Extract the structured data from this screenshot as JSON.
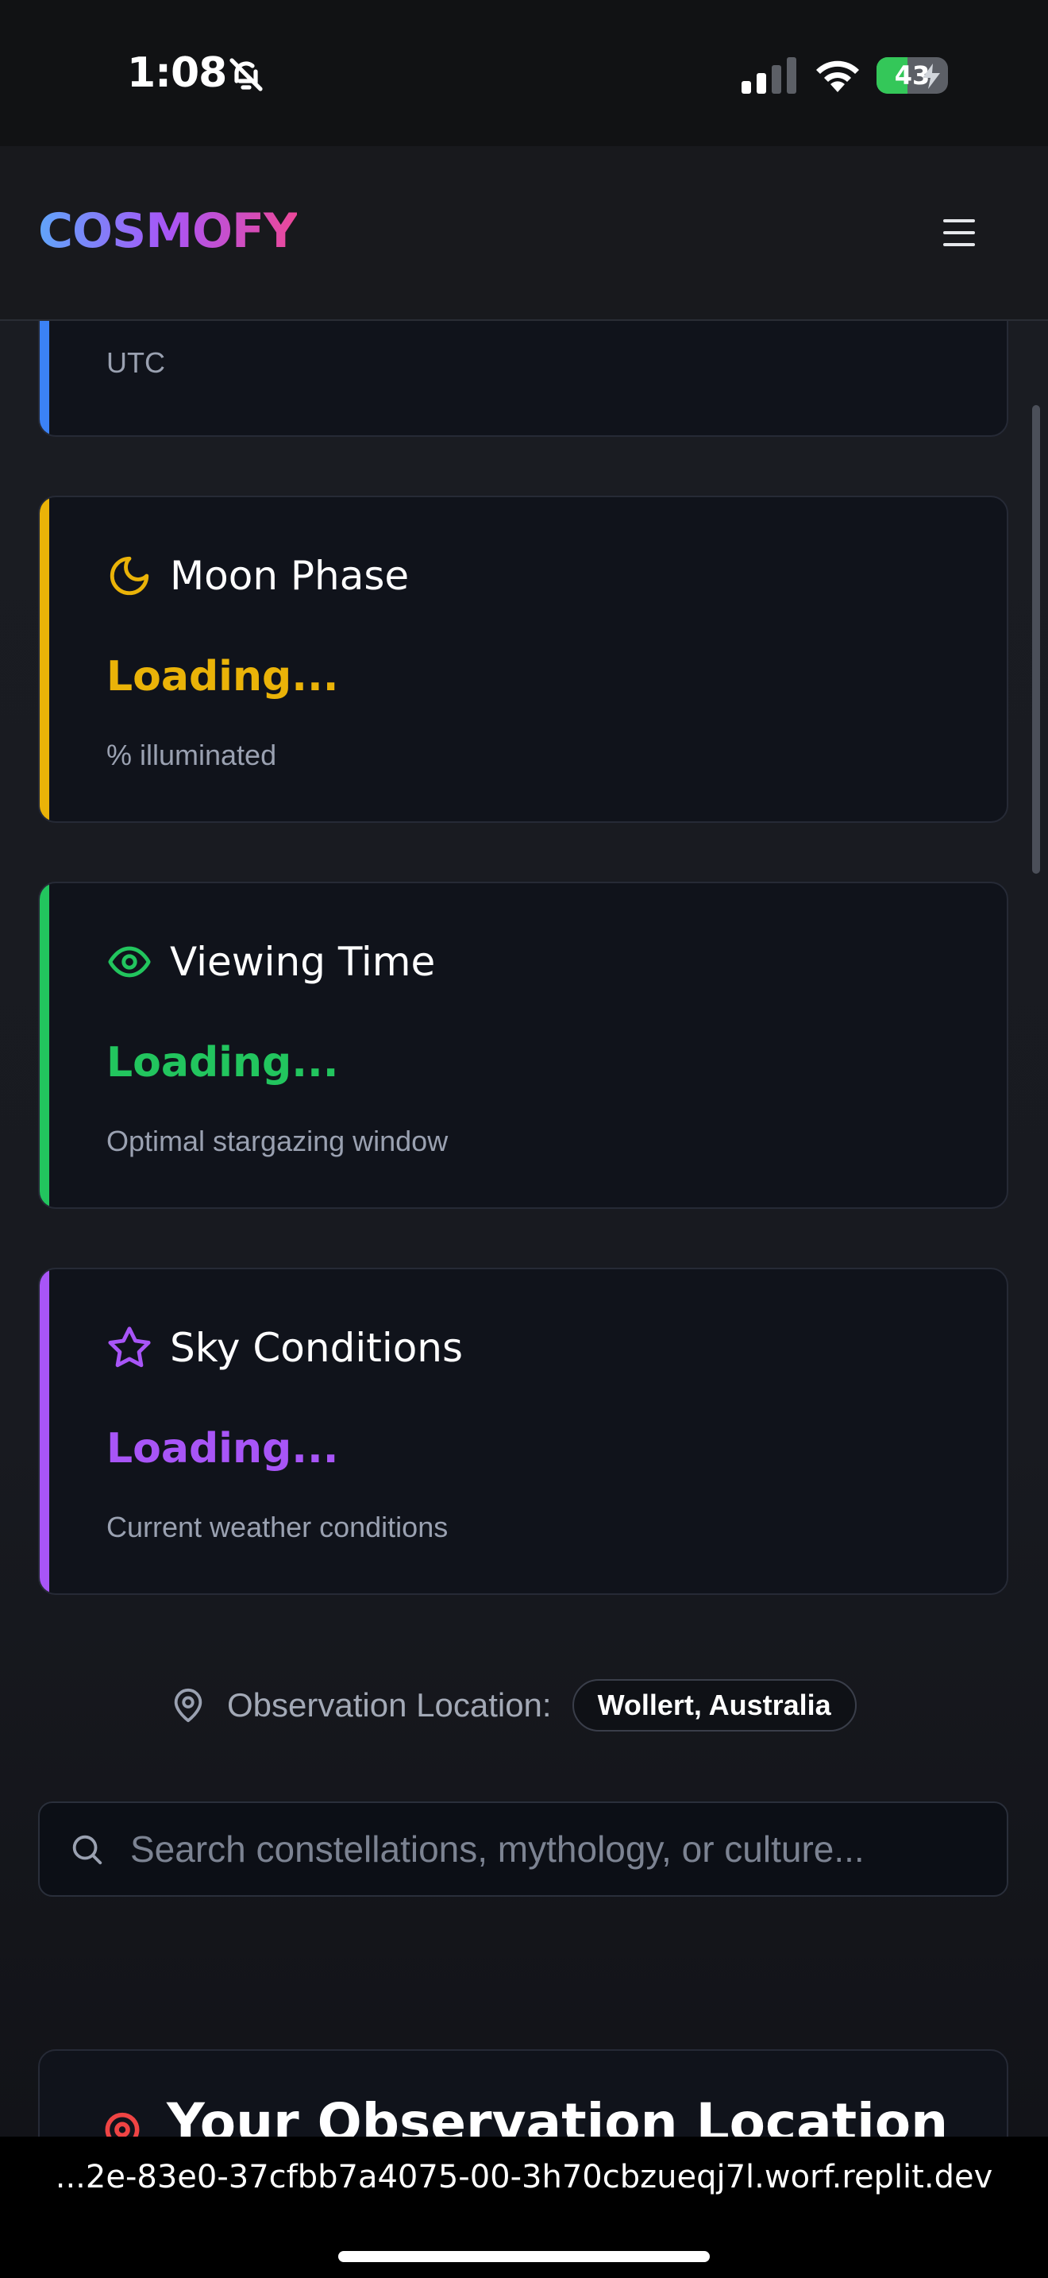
{
  "status_bar": {
    "time": "1:08",
    "battery": "43",
    "battery_level": 0.43,
    "colors": {
      "battery_fill": "#34c759"
    }
  },
  "header": {
    "logo": "COSMOFY",
    "menu_icon": "hamburger-menu-icon"
  },
  "partial_card": {
    "subtitle": "UTC",
    "accent": "#3b82f6"
  },
  "cards": [
    {
      "title": "Moon Phase",
      "value": "Loading...",
      "subtitle": "% illuminated",
      "icon": "moon-icon",
      "accent": "#eab308"
    },
    {
      "title": "Viewing Time",
      "value": "Loading...",
      "subtitle": "Optimal stargazing window",
      "icon": "eye-icon",
      "accent": "#22c55e"
    },
    {
      "title": "Sky Conditions",
      "value": "Loading...",
      "subtitle": "Current weather conditions",
      "icon": "star-icon",
      "accent": "#a855f7"
    }
  ],
  "location": {
    "label": "Observation Location:",
    "value": "Wollert, Australia",
    "icon": "map-pin-icon"
  },
  "search": {
    "placeholder": "Search constellations, mythology, or culture...",
    "icon": "search-icon"
  },
  "observation_section": {
    "title": "Your Observation Location",
    "icon": "location-pin-icon",
    "accent": "#ef4444"
  },
  "browser": {
    "url": "...2e-83e0-37cfbb7a4075-00-3h70cbzueqj7l.worf.replit.dev"
  }
}
